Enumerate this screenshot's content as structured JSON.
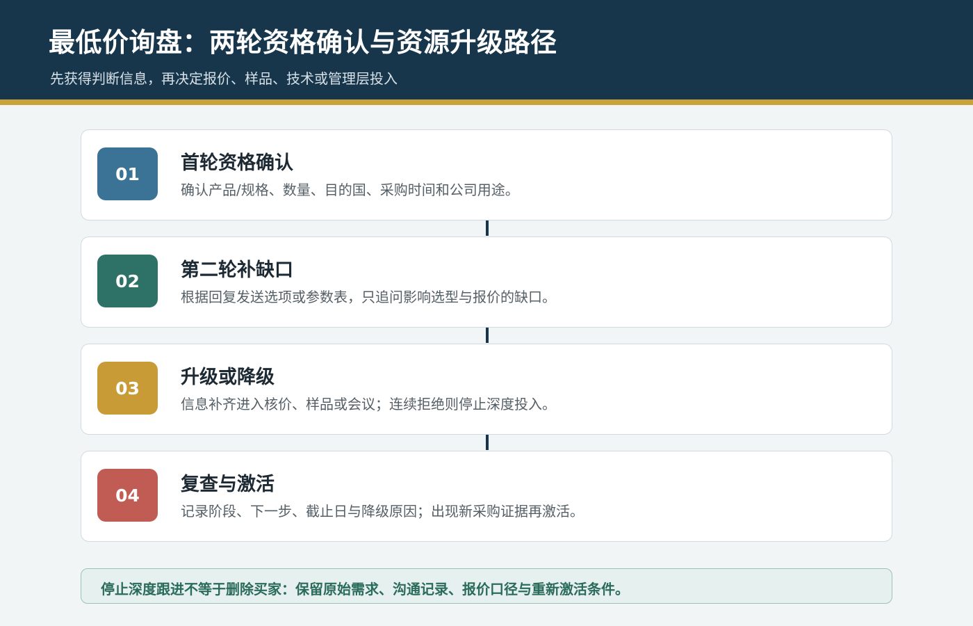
{
  "header": {
    "title": "最低价询盘：两轮资格确认与资源升级路径",
    "subtitle": "先获得判断信息，再决定报价、样品、技术或管理层投入"
  },
  "steps": [
    {
      "number": "01",
      "title": "首轮资格确认",
      "description": "确认产品/规格、数量、目的国、采购时间和公司用途。",
      "color": "#3b7396"
    },
    {
      "number": "02",
      "title": "第二轮补缺口",
      "description": "根据回复发送选项或参数表，只追问影响选型与报价的缺口。",
      "color": "#2d7167"
    },
    {
      "number": "03",
      "title": "升级或降级",
      "description": "信息补齐进入核价、样品或会议；连续拒绝则停止深度投入。",
      "color": "#c99b36"
    },
    {
      "number": "04",
      "title": "复查与激活",
      "description": "记录阶段、下一步、截止日与降级原因；出现新采购证据再激活。",
      "color": "#c05c54"
    }
  ],
  "note": {
    "text": "停止深度跟进不等于删除买家：保留原始需求、沟通记录、报价口径与重新激活条件。"
  },
  "colors": {
    "header_bg": "#17364c",
    "accent": "#c9a23a",
    "page_bg": "#f1f5f6"
  }
}
